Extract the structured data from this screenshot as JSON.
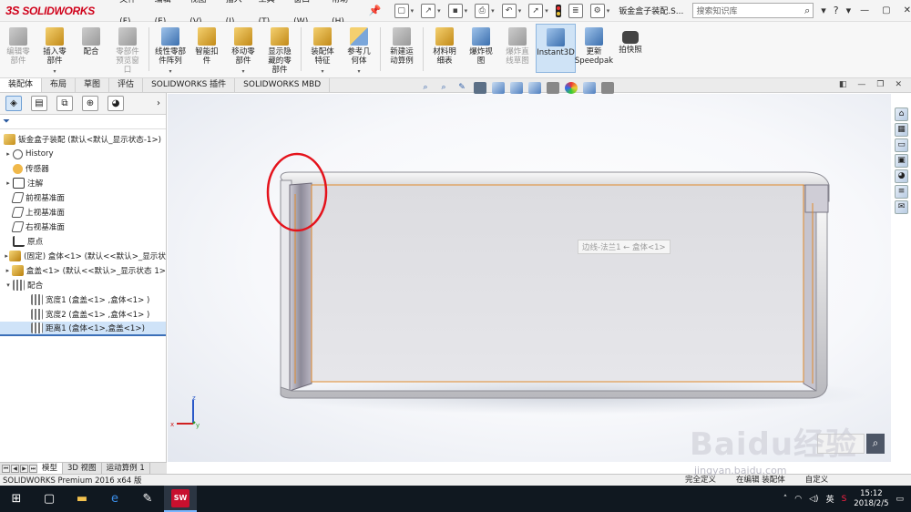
{
  "app": {
    "logo": "SOLIDWORKS",
    "doc_title": "钣金盒子装配.S...",
    "colors": {
      "brand_red": "#d0021b",
      "accent_blue": "#3b6fb8",
      "highlight_circle": "#e4121b",
      "edge_orange": "#e08a2c"
    }
  },
  "menu": [
    "文件(F)",
    "编辑(E)",
    "视图(V)",
    "插入(I)",
    "工具(T)",
    "窗口(W)",
    "帮助(H)"
  ],
  "search": {
    "placeholder": "搜索知识库"
  },
  "ribbon": [
    {
      "label": "编辑零\n部件",
      "icon": "edit-component-icon",
      "disabled": true
    },
    {
      "label": "插入零\n部件",
      "icon": "insert-component-icon",
      "disabled": false
    },
    {
      "label": "配合",
      "icon": "mate-icon",
      "disabled": false
    },
    {
      "label": "零部件\n预览窗\n口",
      "icon": "component-preview-icon",
      "disabled": true
    },
    {
      "label": "线性零部\n件阵列",
      "icon": "linear-pattern-icon",
      "disabled": false
    },
    {
      "label": "智能扣\n件",
      "icon": "smart-fastener-icon",
      "disabled": false
    },
    {
      "label": "移动零\n部件",
      "icon": "move-component-icon",
      "disabled": false
    },
    {
      "label": "显示隐\n藏的零\n部件",
      "icon": "show-hidden-icon",
      "disabled": false
    },
    {
      "label": "装配体\n特征",
      "icon": "assembly-feature-icon",
      "disabled": false
    },
    {
      "label": "参考几\n何体",
      "icon": "reference-geometry-icon",
      "disabled": false
    },
    {
      "label": "新建运\n动算例",
      "icon": "new-motion-study-icon",
      "disabled": false
    },
    {
      "label": "材料明\n细表",
      "icon": "bom-icon",
      "disabled": false
    },
    {
      "label": "爆炸视\n图",
      "icon": "exploded-view-icon",
      "disabled": false
    },
    {
      "label": "爆炸直\n线草图",
      "icon": "explode-line-sketch-icon",
      "disabled": true
    },
    {
      "label": "Instant3D",
      "icon": "instant3d-icon",
      "disabled": false,
      "active": true
    },
    {
      "label": "更新\nSpeedpak",
      "icon": "speedpak-icon",
      "disabled": false
    },
    {
      "label": "拍快照",
      "icon": "snapshot-icon",
      "disabled": false
    }
  ],
  "tabs": [
    "装配体",
    "布局",
    "草图",
    "评估",
    "SOLIDWORKS 插件",
    "SOLIDWORKS MBD"
  ],
  "tree": {
    "root": "钣金盒子装配 (默认<默认_显示状态-1>)",
    "items": [
      {
        "label": "History",
        "icon": "history-icon",
        "toggle": "▸"
      },
      {
        "label": "传感器",
        "icon": "sensor-icon",
        "toggle": ""
      },
      {
        "label": "注解",
        "icon": "annotation-icon",
        "toggle": "▸"
      },
      {
        "label": "前视基准面",
        "icon": "plane-icon",
        "toggle": ""
      },
      {
        "label": "上视基准面",
        "icon": "plane-icon",
        "toggle": ""
      },
      {
        "label": "右视基准面",
        "icon": "plane-icon",
        "toggle": ""
      },
      {
        "label": "原点",
        "icon": "origin-icon",
        "toggle": ""
      },
      {
        "label": "(固定) 盒体<1> (默认<<默认>_显示状",
        "icon": "part-icon",
        "toggle": "▸"
      },
      {
        "label": "盒盖<1> (默认<<默认>_显示状态 1>",
        "icon": "part-icon",
        "toggle": "▸"
      },
      {
        "label": "配合",
        "icon": "mates-folder-icon",
        "toggle": "▾"
      }
    ],
    "mates": [
      {
        "label": "宽度1 (盒盖<1> ,盒体<1> )"
      },
      {
        "label": "宽度2 (盒盖<1> ,盒体<1> )"
      },
      {
        "label": "距离1 (盒体<1>,盒盖<1>)"
      }
    ]
  },
  "bottom_tabs": [
    "模型",
    "3D 视图",
    "运动算例 1"
  ],
  "status": {
    "left": "SOLIDWORKS Premium 2016 x64 版",
    "right": [
      "完全定义",
      "在编辑 装配体",
      "自定义"
    ]
  },
  "viewport": {
    "tooltip": "边线-法兰1 ← 盒体<1>",
    "axes": {
      "x": "x",
      "y": "y",
      "z": "z"
    }
  },
  "watermark": {
    "text": "Baidu经验",
    "url": "jingyan.baidu.com"
  },
  "taskbar": {
    "time": "15:12",
    "date": "2018/2/5",
    "ime": "英"
  }
}
